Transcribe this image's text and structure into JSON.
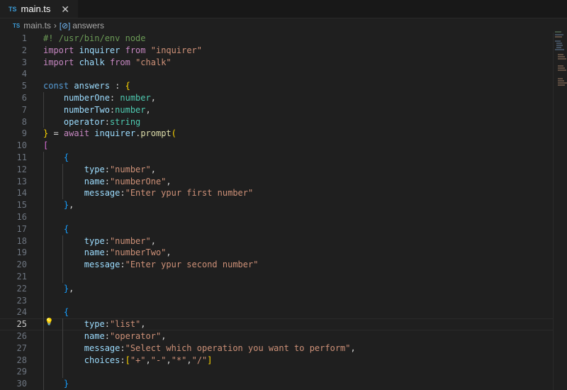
{
  "tab": {
    "lang_badge": "TS",
    "filename": "main.ts",
    "close_glyph": "✕"
  },
  "breadcrumb": {
    "lang_badge": "TS",
    "file": "main.ts",
    "sep": "›",
    "symbol_icon": "[⊘]",
    "symbol": "answers"
  },
  "editor": {
    "active_line": 25,
    "lightbulb_icon": "lightbulb-icon",
    "lines": [
      {
        "n": 1,
        "tokens": [
          {
            "t": "#! /usr/bin/env node",
            "c": "comment"
          }
        ]
      },
      {
        "n": 2,
        "tokens": [
          {
            "t": "import",
            "c": "kw"
          },
          {
            "t": " inquirer ",
            "c": "var"
          },
          {
            "t": "from",
            "c": "kw"
          },
          {
            "t": " ",
            "c": "p"
          },
          {
            "t": "\"inquirer\"",
            "c": "str"
          }
        ]
      },
      {
        "n": 3,
        "tokens": [
          {
            "t": "import",
            "c": "kw"
          },
          {
            "t": " chalk ",
            "c": "var"
          },
          {
            "t": "from",
            "c": "kw"
          },
          {
            "t": " ",
            "c": "p"
          },
          {
            "t": "\"chalk\"",
            "c": "str"
          }
        ]
      },
      {
        "n": 4,
        "tokens": []
      },
      {
        "n": 5,
        "tokens": [
          {
            "t": "const",
            "c": "decl"
          },
          {
            "t": " answers ",
            "c": "var"
          },
          {
            "t": ": ",
            "c": "p"
          },
          {
            "t": "{",
            "c": "b1"
          }
        ]
      },
      {
        "n": 6,
        "tokens": [
          {
            "t": "    numberOne",
            "c": "var"
          },
          {
            "t": ": ",
            "c": "p"
          },
          {
            "t": "number",
            "c": "type"
          },
          {
            "t": ",",
            "c": "p"
          }
        ]
      },
      {
        "n": 7,
        "tokens": [
          {
            "t": "    numberTwo",
            "c": "var"
          },
          {
            "t": ":",
            "c": "p"
          },
          {
            "t": "number",
            "c": "type"
          },
          {
            "t": ",",
            "c": "p"
          }
        ]
      },
      {
        "n": 8,
        "tokens": [
          {
            "t": "    operator",
            "c": "var"
          },
          {
            "t": ":",
            "c": "p"
          },
          {
            "t": "string",
            "c": "type"
          }
        ]
      },
      {
        "n": 9,
        "tokens": [
          {
            "t": "}",
            "c": "b1"
          },
          {
            "t": " = ",
            "c": "p"
          },
          {
            "t": "await",
            "c": "kw"
          },
          {
            "t": " inquirer",
            "c": "var"
          },
          {
            "t": ".",
            "c": "p"
          },
          {
            "t": "prompt",
            "c": "fn"
          },
          {
            "t": "(",
            "c": "b1"
          }
        ]
      },
      {
        "n": 10,
        "tokens": [
          {
            "t": "[",
            "c": "b2"
          }
        ]
      },
      {
        "n": 11,
        "tokens": [
          {
            "t": "    {",
            "c": "b3"
          }
        ]
      },
      {
        "n": 12,
        "tokens": [
          {
            "t": "        type",
            "c": "var"
          },
          {
            "t": ":",
            "c": "p"
          },
          {
            "t": "\"number\"",
            "c": "str"
          },
          {
            "t": ",",
            "c": "p"
          }
        ]
      },
      {
        "n": 13,
        "tokens": [
          {
            "t": "        name",
            "c": "var"
          },
          {
            "t": ":",
            "c": "p"
          },
          {
            "t": "\"numberOne\"",
            "c": "str"
          },
          {
            "t": ",",
            "c": "p"
          }
        ]
      },
      {
        "n": 14,
        "tokens": [
          {
            "t": "        message",
            "c": "var"
          },
          {
            "t": ":",
            "c": "p"
          },
          {
            "t": "\"Enter ypur first number\"",
            "c": "str"
          }
        ]
      },
      {
        "n": 15,
        "tokens": [
          {
            "t": "    }",
            "c": "b3"
          },
          {
            "t": ",",
            "c": "p"
          }
        ]
      },
      {
        "n": 16,
        "tokens": []
      },
      {
        "n": 17,
        "tokens": [
          {
            "t": "    {",
            "c": "b3"
          }
        ]
      },
      {
        "n": 18,
        "tokens": [
          {
            "t": "        type",
            "c": "var"
          },
          {
            "t": ":",
            "c": "p"
          },
          {
            "t": "\"number\"",
            "c": "str"
          },
          {
            "t": ",",
            "c": "p"
          }
        ]
      },
      {
        "n": 19,
        "tokens": [
          {
            "t": "        name",
            "c": "var"
          },
          {
            "t": ":",
            "c": "p"
          },
          {
            "t": "\"numberTwo\"",
            "c": "str"
          },
          {
            "t": ",",
            "c": "p"
          }
        ]
      },
      {
        "n": 20,
        "tokens": [
          {
            "t": "        message",
            "c": "var"
          },
          {
            "t": ":",
            "c": "p"
          },
          {
            "t": "\"Enter ypur second number\"",
            "c": "str"
          }
        ]
      },
      {
        "n": 21,
        "tokens": []
      },
      {
        "n": 22,
        "tokens": [
          {
            "t": "    }",
            "c": "b3"
          },
          {
            "t": ",",
            "c": "p"
          }
        ]
      },
      {
        "n": 23,
        "tokens": []
      },
      {
        "n": 24,
        "tokens": [
          {
            "t": "    {",
            "c": "b3"
          }
        ]
      },
      {
        "n": 25,
        "tokens": [
          {
            "t": "        type",
            "c": "var"
          },
          {
            "t": ":",
            "c": "p"
          },
          {
            "t": "\"list\"",
            "c": "str"
          },
          {
            "t": ",",
            "c": "p"
          }
        ]
      },
      {
        "n": 26,
        "tokens": [
          {
            "t": "        name",
            "c": "var"
          },
          {
            "t": ":",
            "c": "p"
          },
          {
            "t": "\"operator\"",
            "c": "str"
          },
          {
            "t": ",",
            "c": "p"
          }
        ]
      },
      {
        "n": 27,
        "tokens": [
          {
            "t": "        message",
            "c": "var"
          },
          {
            "t": ":",
            "c": "p"
          },
          {
            "t": "\"Select which operation you want to perform\"",
            "c": "str"
          },
          {
            "t": ",",
            "c": "p"
          }
        ]
      },
      {
        "n": 28,
        "tokens": [
          {
            "t": "        choices",
            "c": "var"
          },
          {
            "t": ":",
            "c": "p"
          },
          {
            "t": "[",
            "c": "b1"
          },
          {
            "t": "\"+\"",
            "c": "str"
          },
          {
            "t": ",",
            "c": "p"
          },
          {
            "t": "\"-\"",
            "c": "str"
          },
          {
            "t": ",",
            "c": "p"
          },
          {
            "t": "\"*\"",
            "c": "str"
          },
          {
            "t": ",",
            "c": "p"
          },
          {
            "t": "\"/\"",
            "c": "str"
          },
          {
            "t": "]",
            "c": "b1"
          }
        ]
      },
      {
        "n": 29,
        "tokens": []
      },
      {
        "n": 30,
        "tokens": [
          {
            "t": "    }",
            "c": "b3"
          }
        ]
      }
    ]
  }
}
